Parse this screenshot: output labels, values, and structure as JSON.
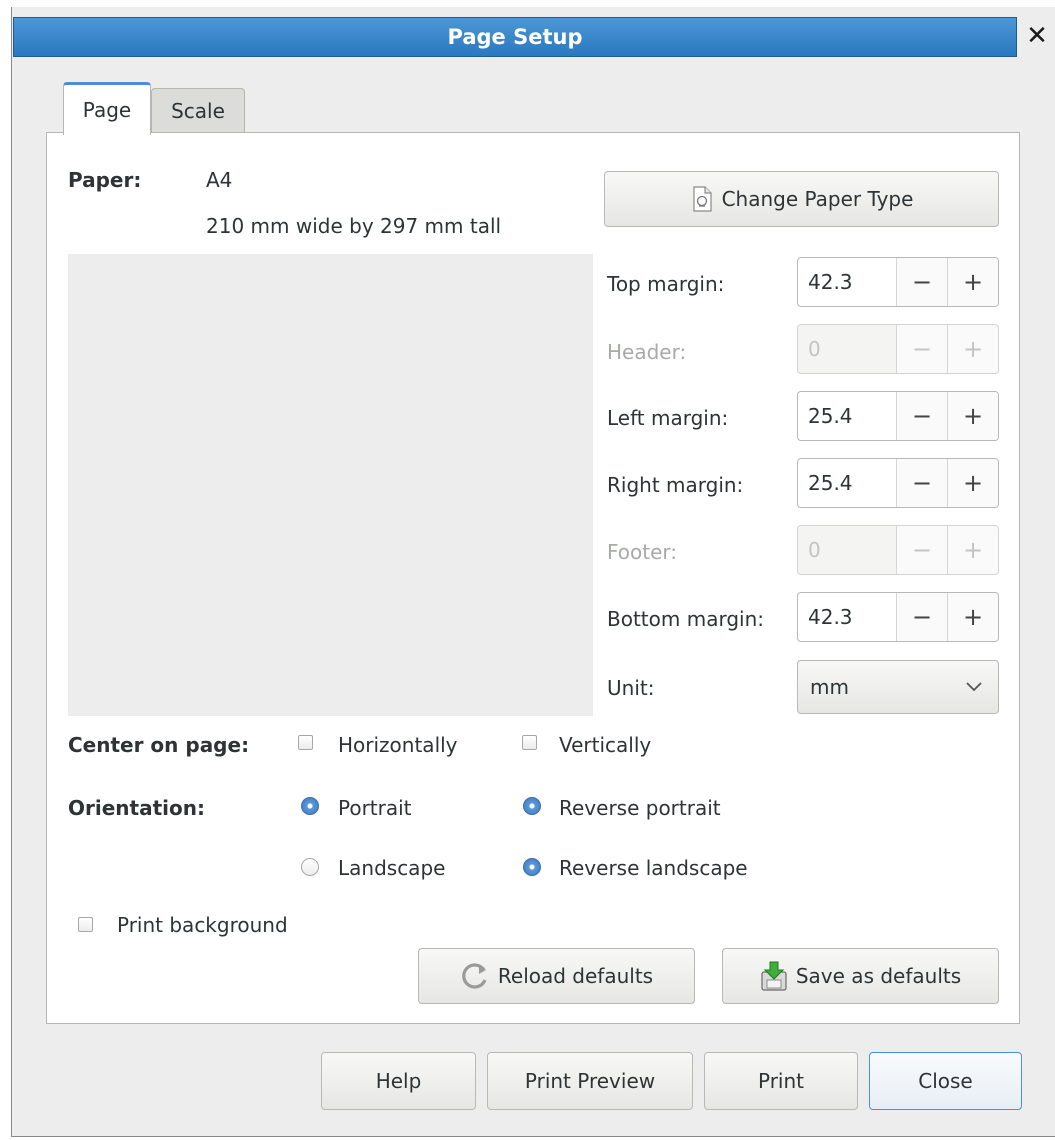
{
  "window": {
    "title": "Page Setup",
    "close_glyph": "✕"
  },
  "tabs": [
    {
      "label": "Page",
      "active": true
    },
    {
      "label": "Scale",
      "active": false
    }
  ],
  "paper": {
    "label": "Paper:",
    "name": "A4",
    "dimensions": "210 mm wide by 297 mm tall"
  },
  "change_paper_button": {
    "label": "Change Paper Type",
    "icon": "paper-type-icon"
  },
  "margins": [
    {
      "label": "Top margin:",
      "value": "42.3",
      "enabled": true
    },
    {
      "label": "Header:",
      "value": "0",
      "enabled": false
    },
    {
      "label": "Left margin:",
      "value": "25.4",
      "enabled": true
    },
    {
      "label": "Right margin:",
      "value": "25.4",
      "enabled": true
    },
    {
      "label": "Footer:",
      "value": "0",
      "enabled": false
    },
    {
      "label": "Bottom margin:",
      "value": "42.3",
      "enabled": true
    }
  ],
  "spin_glyphs": {
    "minus": "−",
    "plus": "+"
  },
  "unit": {
    "label": "Unit:",
    "value": "mm"
  },
  "center_on_page": {
    "label": "Center on page:",
    "horizontally": {
      "label": "Horizontally",
      "checked": false
    },
    "vertically": {
      "label": "Vertically",
      "checked": false
    }
  },
  "orientation": {
    "label": "Orientation:",
    "portrait": {
      "label": "Portrait",
      "selected": true
    },
    "reverse_portrait": {
      "label": "Reverse portrait",
      "selected": true
    },
    "landscape": {
      "label": "Landscape",
      "selected": false
    },
    "reverse_landscape": {
      "label": "Reverse landscape",
      "selected": true
    }
  },
  "print_background": {
    "label": "Print background",
    "checked": false
  },
  "reload_defaults_button": {
    "label": "Reload defaults",
    "icon": "reload-icon"
  },
  "save_defaults_button": {
    "label": "Save as defaults",
    "icon": "save-icon"
  },
  "footer_buttons": {
    "help": "Help",
    "print_preview": "Print Preview",
    "print": "Print",
    "close": "Close"
  },
  "colors": {
    "titlebar": "#3a87cc",
    "active_tab_accent": "#4a90d9",
    "radio_selected": "#4a8bd0"
  }
}
